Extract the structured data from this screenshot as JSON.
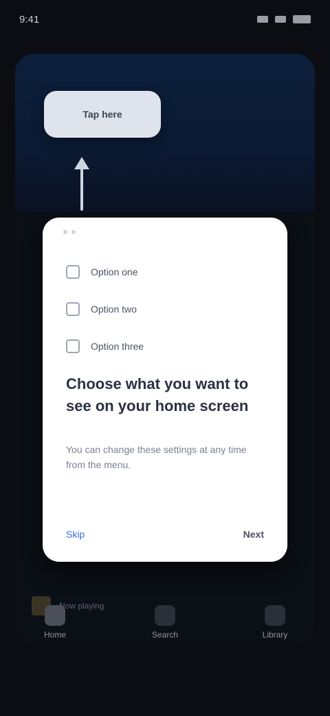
{
  "status_bar": {
    "time": "9:41",
    "battery": "100%"
  },
  "hint": {
    "label": "Tap here"
  },
  "card": {
    "options": [
      {
        "label": "Option one"
      },
      {
        "label": "Option two"
      },
      {
        "label": "Option three"
      }
    ],
    "title": "Choose what you want to see on your home screen",
    "description": "You can change these settings at any time from the menu.",
    "skip_label": "Skip",
    "next_label": "Next"
  },
  "mini_player": {
    "title": "Now playing"
  },
  "bottom_nav": {
    "items": [
      {
        "label": "Home"
      },
      {
        "label": "Search"
      },
      {
        "label": "Library"
      }
    ]
  }
}
